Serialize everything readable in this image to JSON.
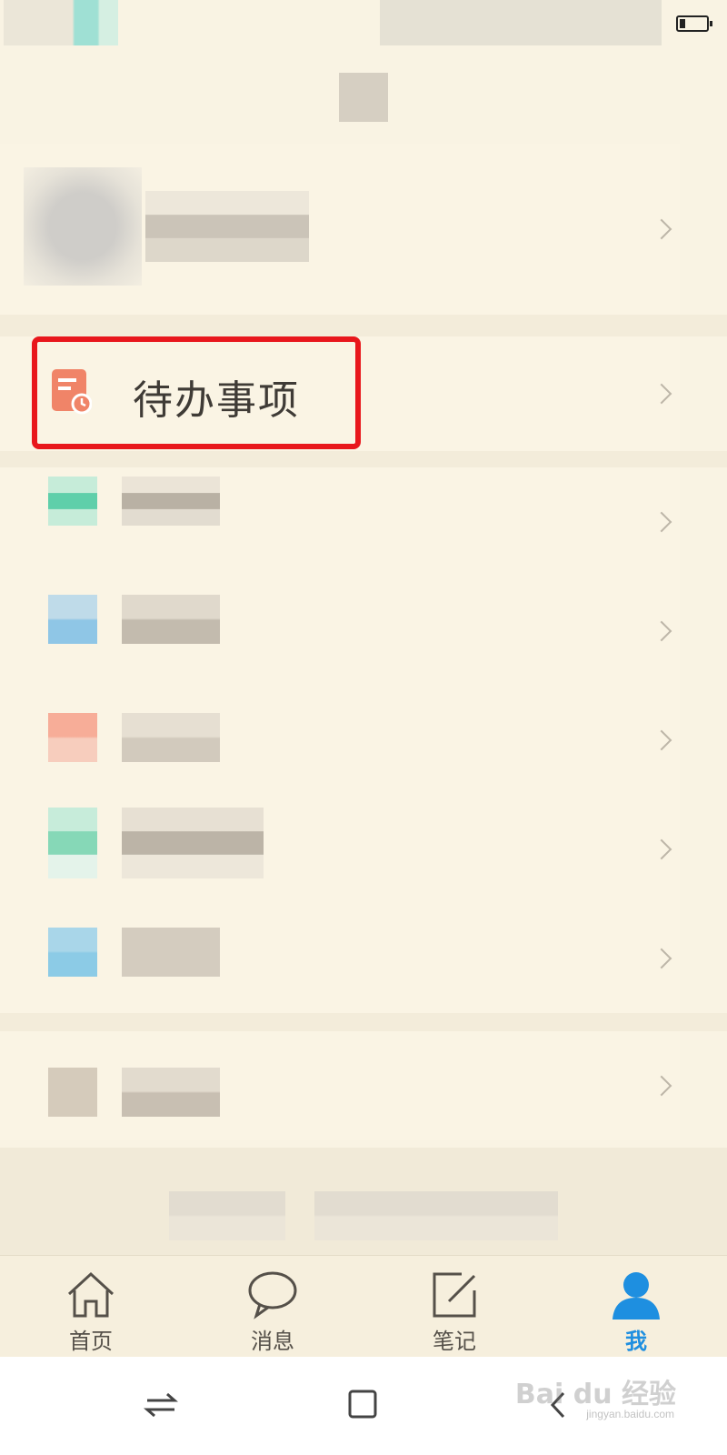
{
  "status_bar": {
    "battery_icon": "battery-icon"
  },
  "todo": {
    "label": "待办事项",
    "icon": "todo-clock-icon",
    "highlight_color": "#e8171c"
  },
  "menu_rows": [
    {
      "icon_color": "#5fcfaa"
    },
    {
      "icon_color": "#8fc6e6"
    },
    {
      "icon_color": "#f7ad98"
    },
    {
      "icon_color": "#86d8b7"
    },
    {
      "icon_color": "#8ccbe6"
    },
    {
      "icon_color": "#d5cbbb"
    }
  ],
  "tabs": [
    {
      "label": "首页",
      "icon": "home-icon"
    },
    {
      "label": "消息",
      "icon": "message-icon"
    },
    {
      "label": "笔记",
      "icon": "note-icon"
    },
    {
      "label": "我",
      "icon": "person-icon",
      "active": true
    }
  ],
  "colors": {
    "accent": "#1e8fe0",
    "background": "#f9f3e3"
  },
  "nav": {
    "icons": [
      "switch-icon",
      "recent-square-icon",
      "back-icon"
    ]
  },
  "watermark": {
    "text": "Bai du 经验",
    "sub": "jingyan.baidu.com"
  }
}
